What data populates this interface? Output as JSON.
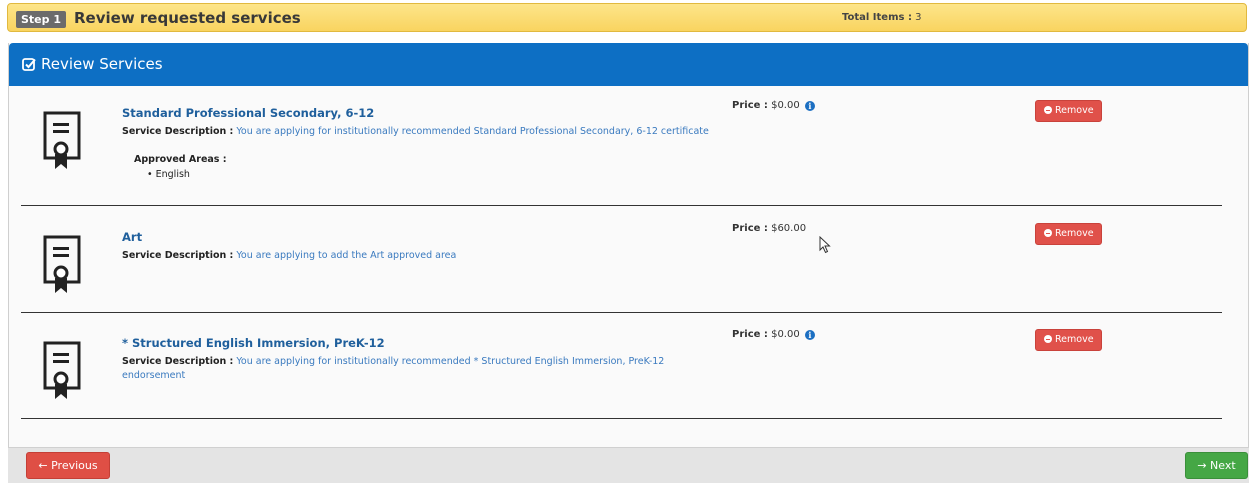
{
  "step": {
    "badge": "Step 1",
    "title": "Review requested services",
    "total_label": "Total Items :",
    "total_value": "3"
  },
  "panel": {
    "title": "Review Services",
    "icon": "check-square-icon"
  },
  "services": [
    {
      "name": "Standard Professional Secondary, 6-12",
      "desc_label": "Service Description :",
      "description": "You are applying for institutionally recommended Standard Professional Secondary, 6-12 certificate",
      "areas_label": "Approved Areas :",
      "areas": [
        "English"
      ],
      "price_label": "Price :",
      "price": "$0.00",
      "price_info": true,
      "remove_label": "Remove"
    },
    {
      "name": "Art",
      "desc_label": "Service Description :",
      "description": "You are applying to add the Art approved area",
      "price_label": "Price :",
      "price": "$60.00",
      "price_info": false,
      "remove_label": "Remove"
    },
    {
      "name": "* Structured English Immersion, PreK-12",
      "desc_label": "Service Description :",
      "description": "You are applying for institutionally recommended * Structured English Immersion, PreK-12 endorsement",
      "price_label": "Price :",
      "price": "$0.00",
      "price_info": true,
      "remove_label": "Remove"
    }
  ],
  "footer": {
    "previous_label": "Previous",
    "next_label": "Next"
  },
  "colors": {
    "header_bar": "#f9d460",
    "panel_heading": "#0d6fc4",
    "remove": "#e0514a",
    "previous": "#df4f45",
    "next": "#45a745"
  }
}
